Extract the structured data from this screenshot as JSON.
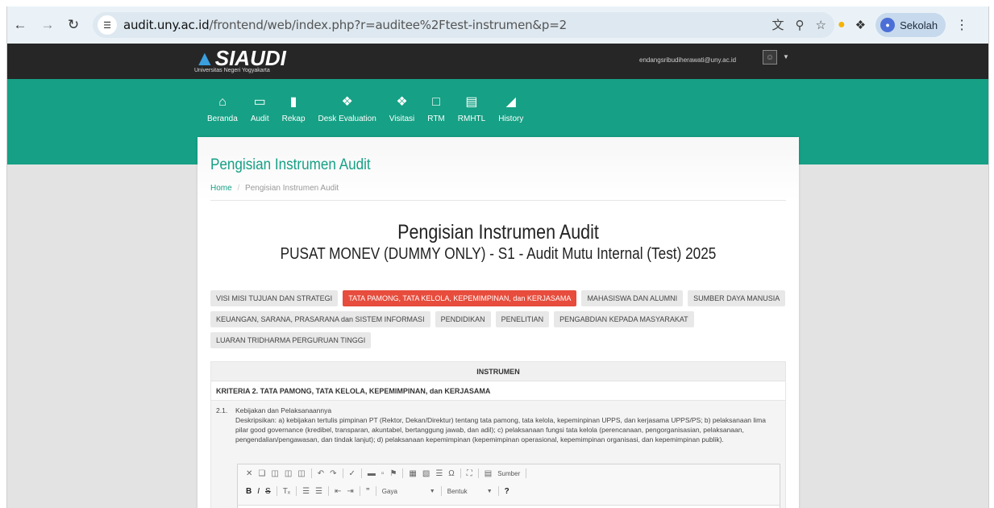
{
  "browser": {
    "url_host": "audit.uny.ac.id",
    "url_path": "/frontend/web/index.php?r=auditee%2Ftest-instrumen&p=2",
    "profile_name": "Sekolah"
  },
  "header": {
    "logo_text": "SIAUDI",
    "logo_subtitle": "Universitas Negeri Yogyakarta",
    "user_email": "endangsribudiherawati@uny.ac.id"
  },
  "menu": [
    {
      "label": "Beranda",
      "icon": "home-icon"
    },
    {
      "label": "Audit",
      "icon": "monitor-icon"
    },
    {
      "label": "Rekap",
      "icon": "file-icon"
    },
    {
      "label": "Desk Evaluation",
      "icon": "comments-icon"
    },
    {
      "label": "Visitasi",
      "icon": "comment-icon"
    },
    {
      "label": "RTM",
      "icon": "document-icon"
    },
    {
      "label": "RMHTL",
      "icon": "list-icon"
    },
    {
      "label": "History",
      "icon": "folder-open-icon"
    }
  ],
  "page": {
    "title": "Pengisian Instrumen Audit",
    "breadcrumb_home": "Home",
    "breadcrumb_sep": "/",
    "breadcrumb_current": "Pengisian Instrumen Audit",
    "main_title": "Pengisian Instrumen Audit",
    "sub_title": "PUSAT MONEV (DUMMY ONLY) - S1 - Audit Mutu Internal (Test) 2025"
  },
  "tabs": [
    {
      "label": "VISI MISI TUJUAN DAN STRATEGI",
      "active": false
    },
    {
      "label": "TATA PAMONG, TATA KELOLA, KEPEMIMPINAN, dan KERJASAMA",
      "active": true
    },
    {
      "label": "MAHASISWA DAN ALUMNI",
      "active": false
    },
    {
      "label": "SUMBER DAYA MANUSIA",
      "active": false
    },
    {
      "label": "KEUANGAN, SARANA, PRASARANA dan SISTEM INFORMASI",
      "active": false
    },
    {
      "label": "PENDIDIKAN",
      "active": false
    },
    {
      "label": "PENELITIAN",
      "active": false
    },
    {
      "label": "PENGABDIAN KEPADA MASYARAKAT",
      "active": false
    },
    {
      "label": "LUARAN TRIDHARMA PERGURUAN TINGGI",
      "active": false
    }
  ],
  "table": {
    "header": "INSTRUMEN",
    "kriteria": "KRITERIA 2. TATA PAMONG, TATA KELOLA, KEPEMIMPINAN, dan KERJASAMA",
    "item_number": "2.1.",
    "item_title": "Kebijakan dan Pelaksanaannya",
    "item_description": "Deskripsikan: a) kebijakan tertulis pimpinan PT (Rektor, Dekan/Direktur) tentang tata pamong, tata kelola, kepeminpinan UPPS, dan kerjasama UPPS/PS; b) pelaksanaan lima pilar good governance (kredibel, transparan, akuntabel, bertanggung jawab, dan adil); c) pelaksanaan fungsi tata kelola (perencanaan, pengorganisasian, pelaksanaan, pengendalian/pengawasan, dan tindak lanjut); d) pelaksanaan kepemimpinan (kepemimpinan operasional, kepemimpinan organisasi, dan kepemimpinan publik)."
  },
  "editor": {
    "source_label": "Sumber",
    "style_label": "Gaya",
    "format_label": "Bentuk",
    "help_label": "?"
  }
}
